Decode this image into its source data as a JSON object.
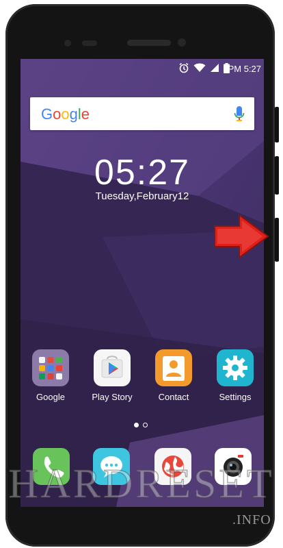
{
  "status_bar": {
    "time": "PM 5:27",
    "icons": [
      "alarm-icon",
      "wifi-icon",
      "signal-icon",
      "battery-icon"
    ]
  },
  "search_widget": {
    "logo_text": "Google",
    "mic_icon": "mic-icon"
  },
  "clock": {
    "time": "05:27",
    "date": "Tuesday,February12"
  },
  "apps": [
    {
      "label": "Google",
      "icon": "google-folder-icon"
    },
    {
      "label": "Play Story",
      "icon": "play-store-icon"
    },
    {
      "label": "Contact",
      "icon": "contact-icon"
    },
    {
      "label": "Settings",
      "icon": "settings-icon"
    }
  ],
  "page_indicator": {
    "count": 2,
    "active": 0
  },
  "dock": [
    {
      "name": "phone",
      "icon": "phone-icon"
    },
    {
      "name": "messages",
      "icon": "message-icon"
    },
    {
      "name": "browser",
      "icon": "browser-icon"
    },
    {
      "name": "camera",
      "icon": "camera-icon"
    }
  ],
  "watermark": {
    "main": "HARDRESET",
    "suffix": ".INFO"
  },
  "colors": {
    "wallpaper_dark": "#2f2350",
    "wallpaper_mid": "#4b3672",
    "wallpaper_light": "#6a4f95",
    "arrow": "#e0201b"
  }
}
